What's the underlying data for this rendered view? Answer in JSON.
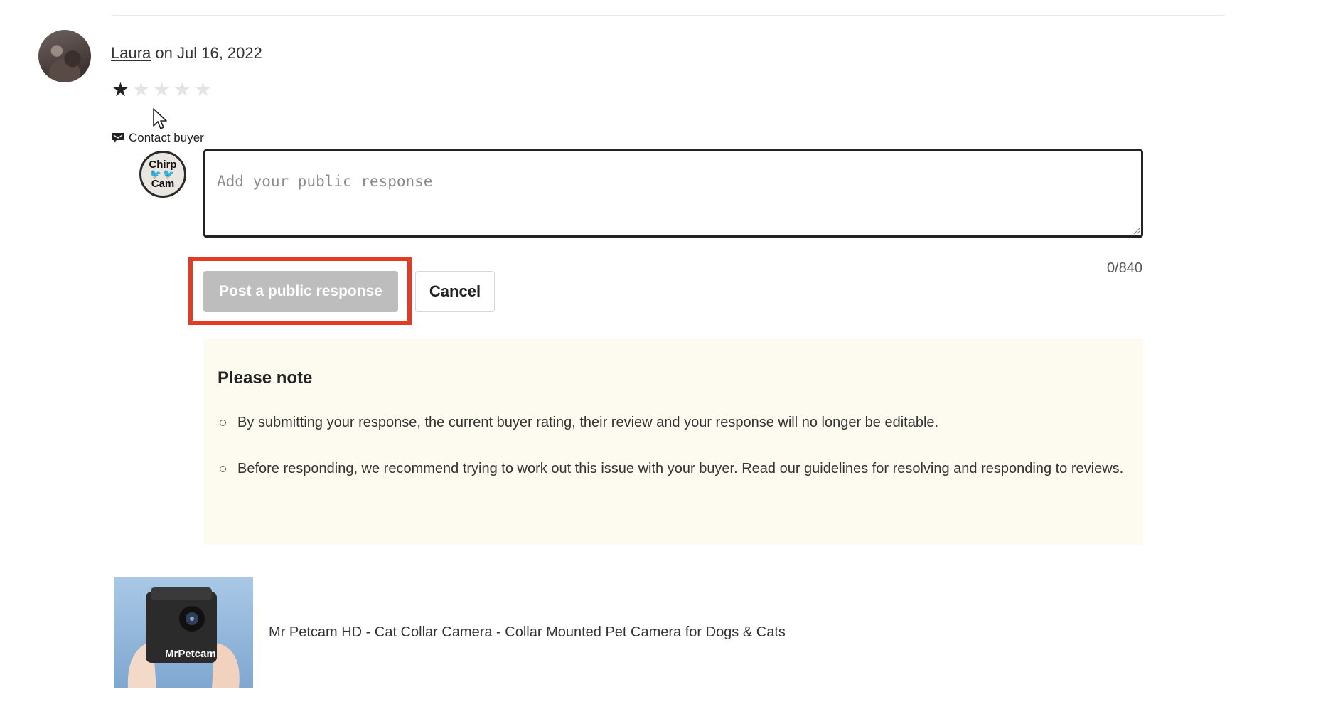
{
  "review": {
    "reviewer_name": "Laura",
    "date_text": "on Jul 16, 2022",
    "rating": 1,
    "max_rating": 5,
    "contact_buyer_label": "Contact buyer"
  },
  "shop_avatar": {
    "line1": "Chirp",
    "line2": "Cam"
  },
  "response": {
    "placeholder": "Add your public response",
    "value": "",
    "char_count": "0/840"
  },
  "actions": {
    "post_label": "Post a public response",
    "cancel_label": "Cancel"
  },
  "note": {
    "title": "Please note",
    "items": [
      "By submitting your response, the current buyer rating, their review and your response will no longer be editable.",
      "Before responding, we recommend trying to work out this issue with your buyer. Read our guidelines for resolving and responding to reviews."
    ]
  },
  "product": {
    "title": "Mr Petcam HD - Cat Collar Camera - Collar Mounted Pet Camera for Dogs & Cats",
    "thumb_brand": "MrPetcam"
  },
  "colors": {
    "highlight": "#e43b24",
    "note_bg": "#fdfaef",
    "disabled_button": "#bdbdbd"
  },
  "icons": {
    "contact": "message-icon",
    "star_filled": "star-filled-icon",
    "star_empty": "star-empty-icon",
    "cursor": "mouse-pointer-icon"
  }
}
